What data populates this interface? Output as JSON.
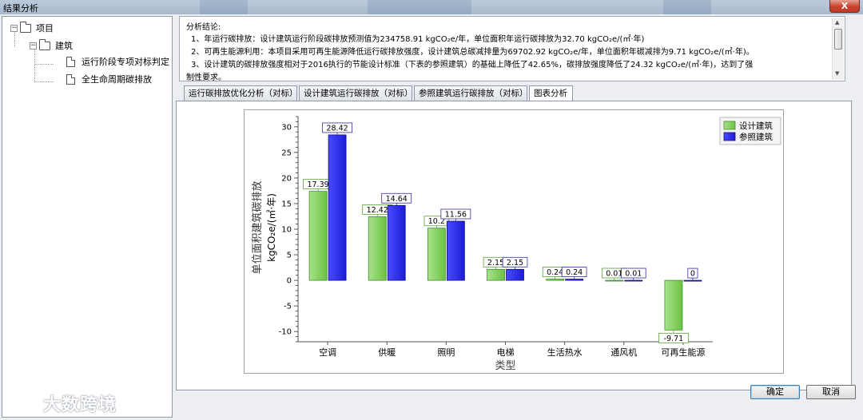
{
  "window": {
    "title": "结果分析",
    "close_label": "X"
  },
  "tree": {
    "root": "项目",
    "child": "建筑",
    "leaves": [
      "运行阶段专项对标判定",
      "全生命周期碳排放"
    ]
  },
  "conclusion": {
    "heading": "分析结论:",
    "lines": [
      "1、年运行碳排放：设计建筑运行阶段碳排放预测值为234758.91 kgCO₂e/年，单位面积年运行碳排放为32.70 kgCO₂e/(㎡·年)",
      "2、可再生能源利用：本项目采用可再生能源降低运行碳排放强度，设计建筑总碳减排量为69702.92 kgCO₂e/年，单位面积年碳减排为9.71 kgCO₂e/(㎡·年)。",
      "3、设计建筑的碳排放强度相对于2016执行的节能设计标准（下表的参照建筑）的基础上降低了42.65%，碳排放强度降低了24.32 kgCO₂e/(㎡·年)，达到了强",
      "制性要求。"
    ]
  },
  "tabs": [
    "运行碳排放优化分析（对标）",
    "设计建筑运行碳排放（对标）",
    "参照建筑运行碳排放（对标）",
    "图表分析"
  ],
  "active_tab": 3,
  "buttons": {
    "ok": "确定",
    "cancel": "取消"
  },
  "watermark": "大数跨境",
  "colors": {
    "series_design": "#7fcf5a",
    "series_reference": "#2020e0"
  },
  "chart_data": {
    "type": "bar",
    "categories": [
      "空调",
      "供暖",
      "照明",
      "电梯",
      "生活热水",
      "通风机",
      "可再生能源"
    ],
    "series": [
      {
        "name": "设计建筑",
        "values": [
          17.39,
          12.42,
          10.2,
          2.15,
          0.24,
          0.01,
          -9.71
        ],
        "labels": [
          "17.39",
          "12.42",
          "10.2",
          "2.15",
          "0.24",
          "0.01",
          "-9.71"
        ]
      },
      {
        "name": "参照建筑",
        "values": [
          28.42,
          14.64,
          11.56,
          2.15,
          0.24,
          0.01,
          0
        ],
        "labels": [
          "28.42",
          "14.64",
          "11.56",
          "2.15",
          "0.24",
          "0.01",
          "0"
        ]
      }
    ],
    "xlabel": "类型",
    "ylabel_line1": "单位面积建筑碳排放",
    "ylabel_line2": "kgCO₂e/(㎡·年)",
    "ylim": [
      -12,
      32
    ],
    "yticks": [
      -10,
      -5,
      0,
      5,
      10,
      15,
      20,
      25,
      30
    ],
    "legend_position": "top-right"
  }
}
